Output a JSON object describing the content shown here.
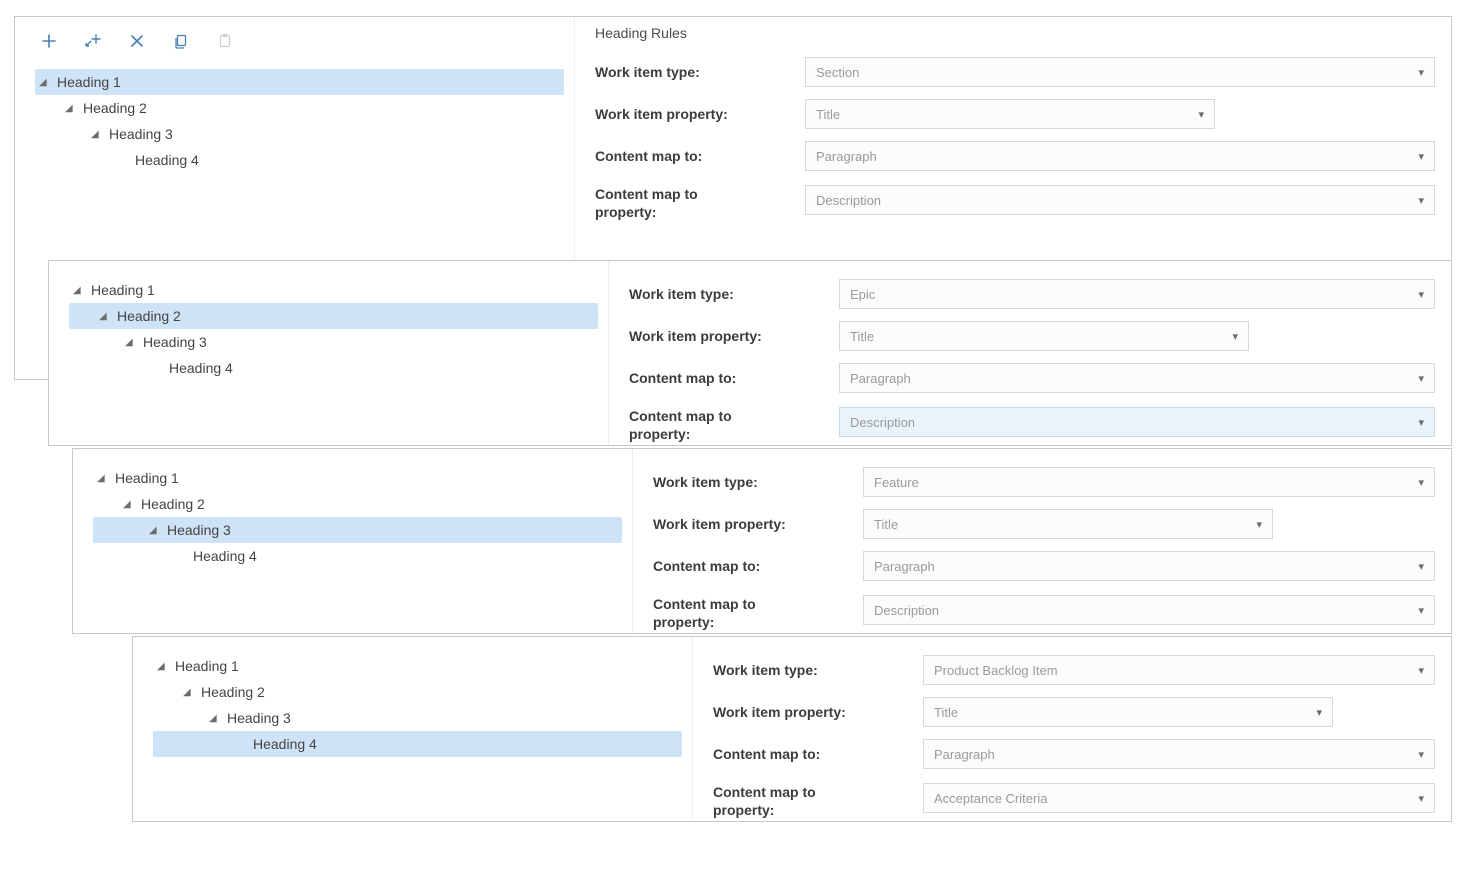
{
  "title": "Heading Rules",
  "labels": {
    "wit": "Work item type:",
    "wip": "Work item property:",
    "cmt": "Content map to:",
    "cmtp_l1": "Content map to",
    "cmtp_l2": "property:"
  },
  "tree": [
    {
      "label": "Heading 1",
      "indent": 0
    },
    {
      "label": "Heading 2",
      "indent": 1
    },
    {
      "label": "Heading 3",
      "indent": 2
    },
    {
      "label": "Heading 4",
      "indent": 3
    }
  ],
  "panels": [
    {
      "selectedIndex": 0,
      "form": {
        "workItemType": "Section",
        "workItemProperty": "Title",
        "contentMapTo": "Paragraph",
        "contentMapToProperty": "Description"
      }
    },
    {
      "selectedIndex": 1,
      "form": {
        "workItemType": "Epic",
        "workItemProperty": "Title",
        "contentMapTo": "Paragraph",
        "contentMapToProperty": "Description"
      }
    },
    {
      "selectedIndex": 2,
      "form": {
        "workItemType": "Feature",
        "workItemProperty": "Title",
        "contentMapTo": "Paragraph",
        "contentMapToProperty": "Description"
      }
    },
    {
      "selectedIndex": 3,
      "form": {
        "workItemType": "Product Backlog Item",
        "workItemProperty": "Title",
        "contentMapTo": "Paragraph",
        "contentMapToProperty": "Acceptance Criteria"
      }
    }
  ]
}
